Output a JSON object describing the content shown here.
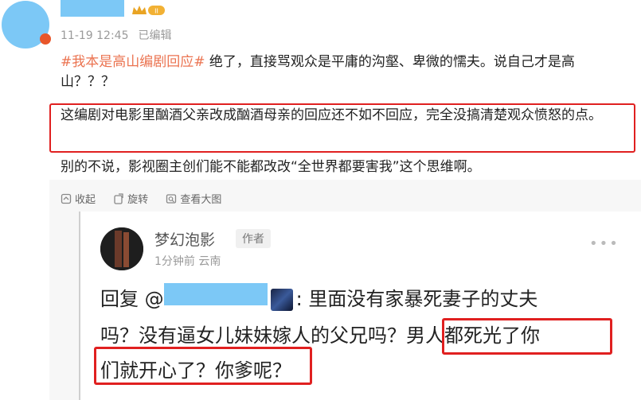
{
  "post": {
    "timestamp": "11-19 12:45",
    "edited_label": "已编辑",
    "vip_label": "II",
    "topic": "#我本是高山编剧回应#",
    "line1_rest": " 绝了，直接骂观众是平庸的沟壑、卑微的懦夫。说自己才是高山？？？",
    "line2": "这编剧对电影里酗酒父亲改成酗酒母亲的回应还不如不回应，完全没搞清楚观众愤怒的点。",
    "line3": "别的不说，影视圈主创们能不能都改改“全世界都要害我”这个思维啊。"
  },
  "actions": {
    "collapse": "收起",
    "rotate": "旋转",
    "view_large": "查看大图"
  },
  "reply": {
    "name": "梦幻泡影",
    "author_tag": "作者",
    "meta": "1分钟前 云南",
    "line1_prefix": "回复 @",
    "line1_rest": ": 里面没有家暴死妻子的丈夫",
    "line2_a": "吗？没有逼女儿妹妹嫁人的父兄吗？",
    "line2_b": "男人都死光了你",
    "line3": "们就开心了？你爹呢？"
  },
  "colors": {
    "topic": "#eb7350",
    "highlight_box": "#e02020",
    "mask": "#7cc8f6"
  }
}
